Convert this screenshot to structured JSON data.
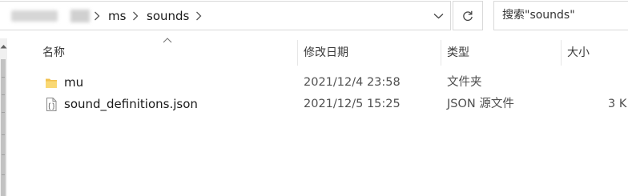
{
  "address": {
    "crumbs": [
      "ms",
      "sounds"
    ],
    "search_text": "搜索\"sounds\""
  },
  "columns": {
    "name": "名称",
    "modified": "修改日期",
    "type": "类型",
    "size": "大小"
  },
  "files": [
    {
      "name": "mu",
      "modified": "2021/12/4 23:58",
      "type": "文件夹",
      "size": "",
      "icon": "folder-icon"
    },
    {
      "name": "sound_definitions.json",
      "modified": "2021/12/5 15:25",
      "type": "JSON 源文件",
      "size": "3 K",
      "icon": "json-file-icon"
    }
  ]
}
